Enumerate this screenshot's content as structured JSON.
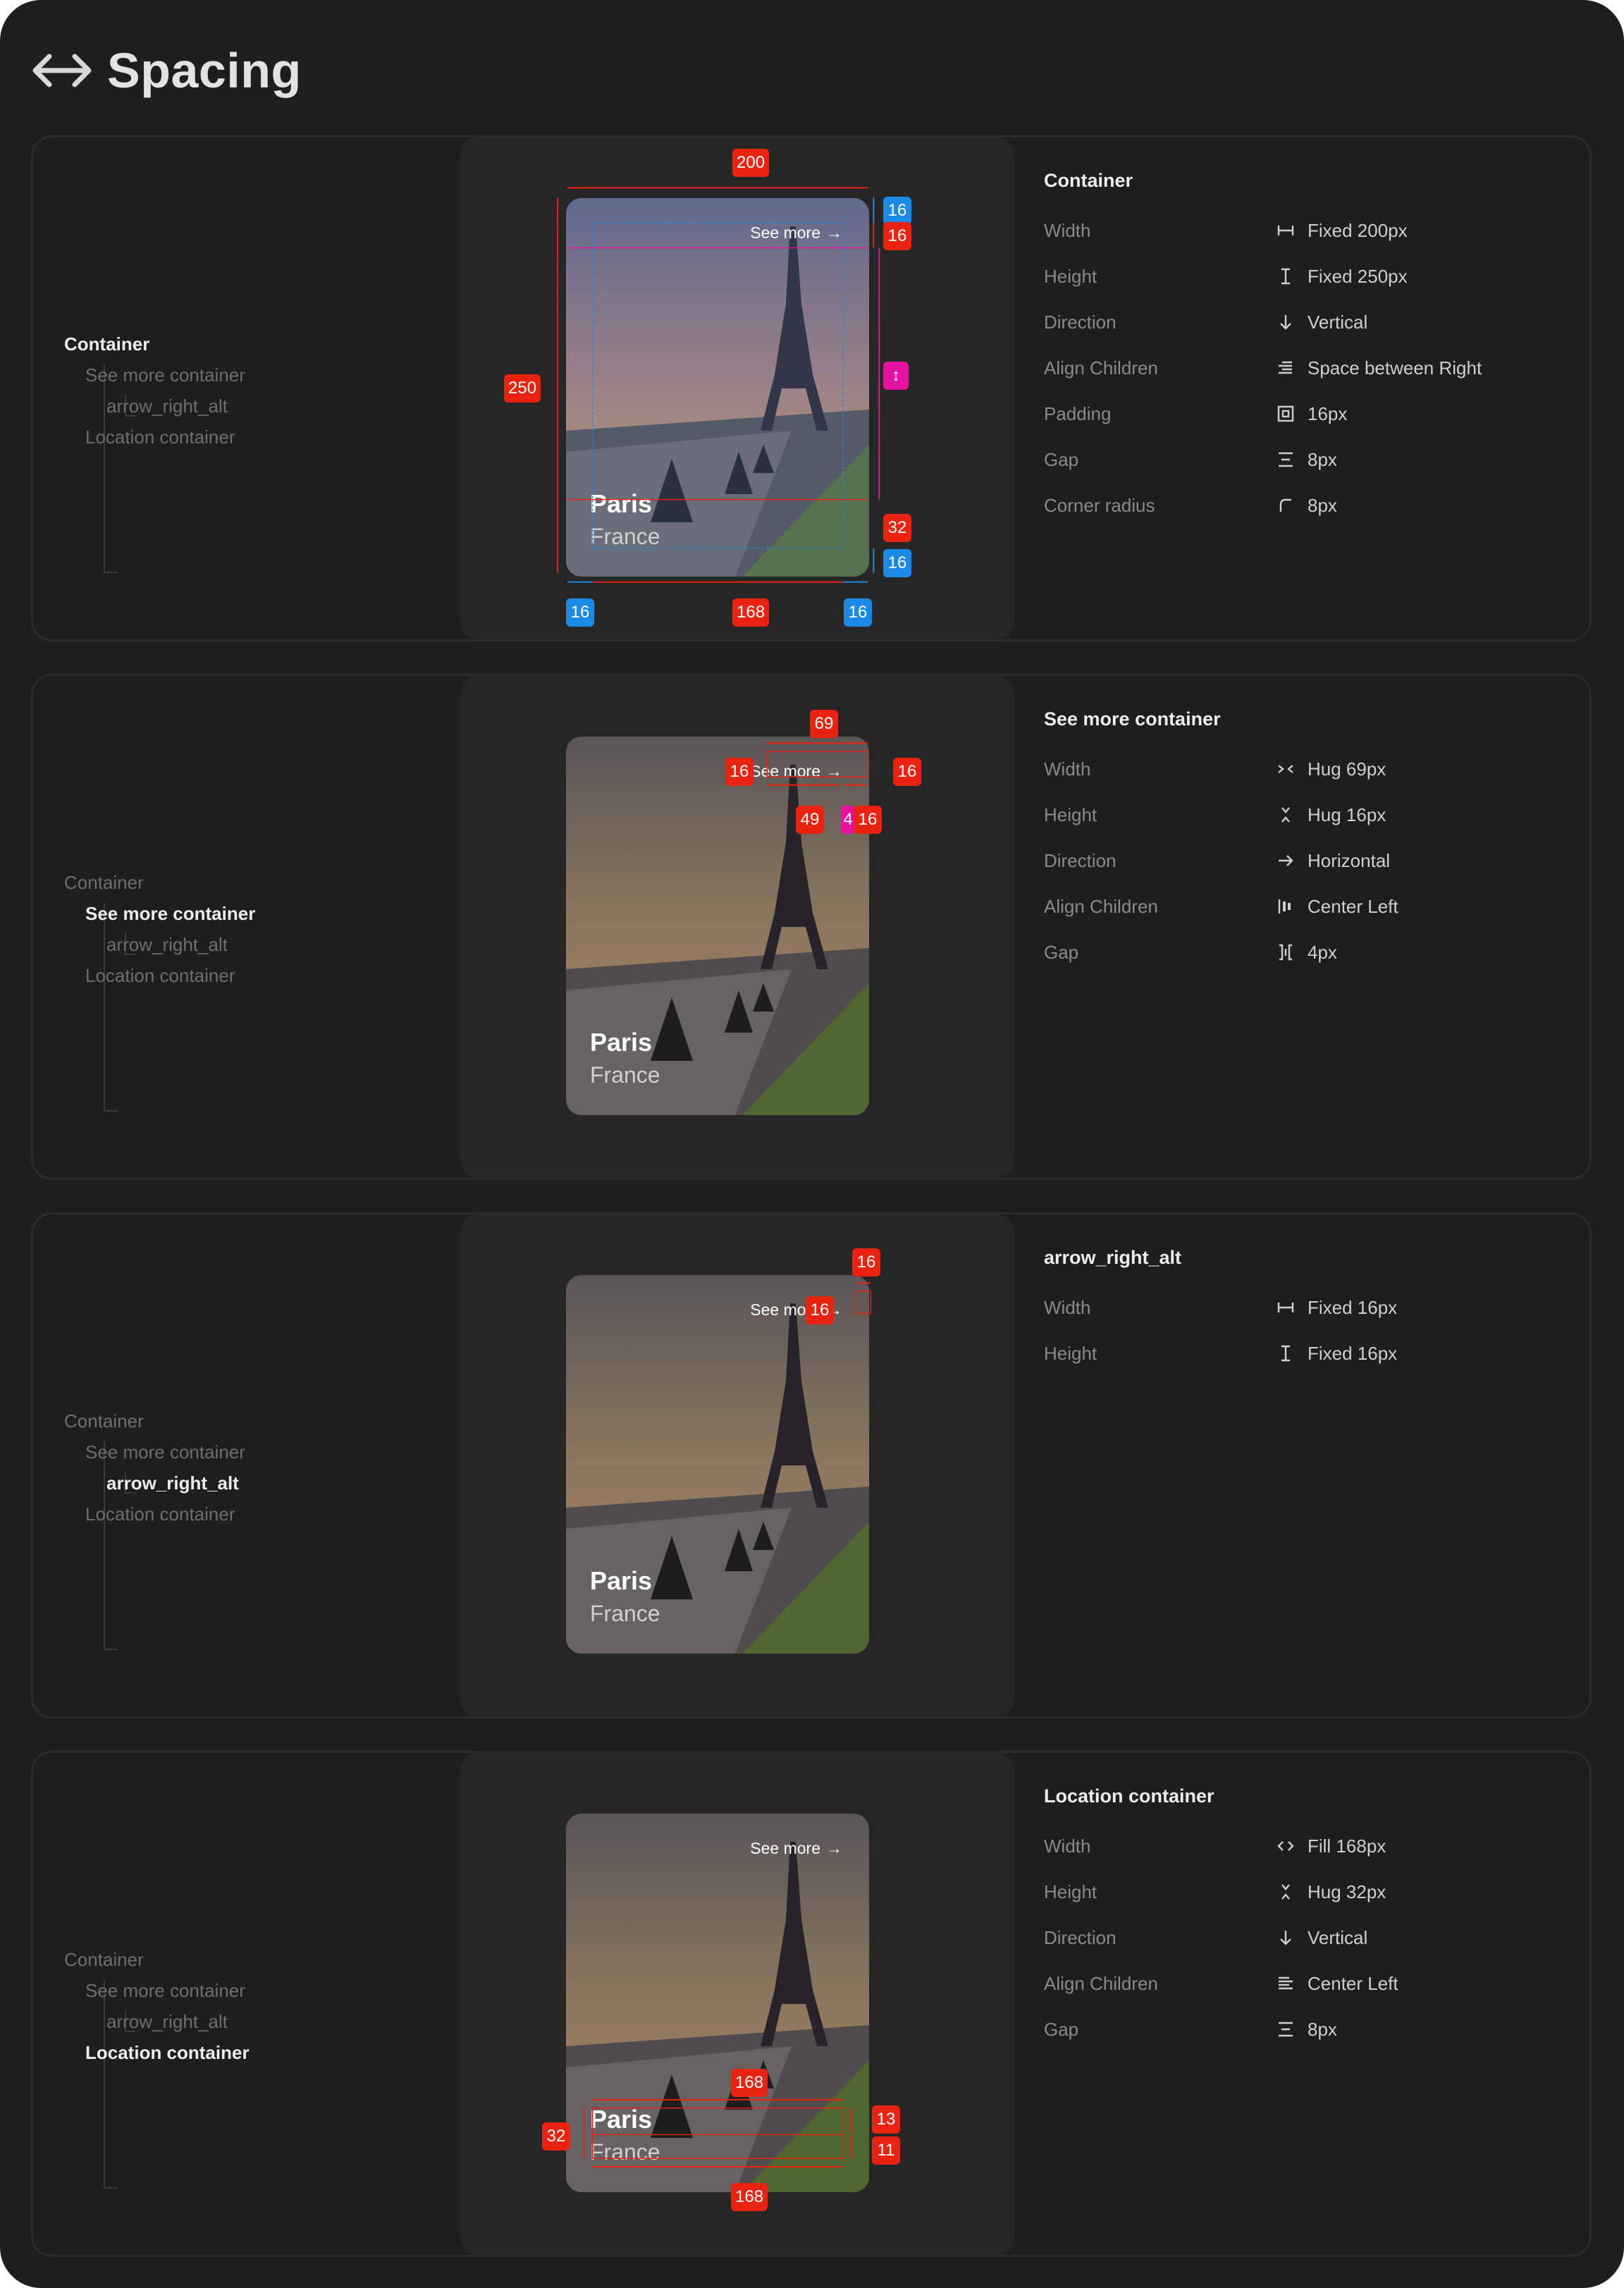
{
  "header": {
    "title": "Spacing"
  },
  "card": {
    "see_more": "See more",
    "city": "Paris",
    "country": "France"
  },
  "panels": [
    {
      "tree": [
        "Container",
        "See more container",
        "arrow_right_alt",
        "Location container"
      ],
      "props_title": "Container",
      "props": [
        {
          "label": "Width",
          "icon": "width-icon",
          "value": "Fixed  200px"
        },
        {
          "label": "Height",
          "icon": "height-icon",
          "value": "Fixed  250px"
        },
        {
          "label": "Direction",
          "icon": "arrow-down-icon",
          "value": "Vertical"
        },
        {
          "label": "Align Children",
          "icon": "align-right-icon",
          "value": "Space between Right"
        },
        {
          "label": "Padding",
          "icon": "padding-icon",
          "value": "16px"
        },
        {
          "label": "Gap",
          "icon": "gap-vertical-icon",
          "value": "8px"
        },
        {
          "label": "Corner radius",
          "icon": "corner-radius-icon",
          "value": "8px"
        }
      ],
      "badges": {
        "w": "200",
        "h": "250",
        "pad_top": "16",
        "sm_h": "16",
        "loc_h": "32",
        "pad_bottom": "16",
        "pad_left": "16",
        "inner_w": "168",
        "pad_right": "16"
      }
    },
    {
      "tree": [
        "Container",
        "See more container",
        "arrow_right_alt",
        "Location container"
      ],
      "props_title": "See more container",
      "props": [
        {
          "label": "Width",
          "icon": "hug-width-icon",
          "value": "Hug  69px"
        },
        {
          "label": "Height",
          "icon": "hug-height-icon",
          "value": "Hug  16px"
        },
        {
          "label": "Direction",
          "icon": "arrow-right-icon",
          "value": "Horizontal"
        },
        {
          "label": "Align Children",
          "icon": "align-center-left-icon",
          "value": "Center Left"
        },
        {
          "label": "Gap",
          "icon": "gap-horizontal-icon",
          "value": "4px"
        }
      ],
      "badges": {
        "w": "69",
        "h_left": "16",
        "h_right": "16",
        "text_w": "49",
        "gap": "4",
        "icon_w": "16"
      }
    },
    {
      "tree": [
        "Container",
        "See more container",
        "arrow_right_alt",
        "Location container"
      ],
      "props_title": "arrow_right_alt",
      "props": [
        {
          "label": "Width",
          "icon": "width-icon",
          "value": "Fixed  16px"
        },
        {
          "label": "Height",
          "icon": "height-icon",
          "value": "Fixed  16px"
        }
      ],
      "badges": {
        "w": "16",
        "h": "16"
      }
    },
    {
      "tree": [
        "Container",
        "See more container",
        "arrow_right_alt",
        "Location container"
      ],
      "props_title": "Location container",
      "props": [
        {
          "label": "Width",
          "icon": "fill-width-icon",
          "value": "Fill  168px"
        },
        {
          "label": "Height",
          "icon": "hug-height-icon",
          "value": "Hug  32px"
        },
        {
          "label": "Direction",
          "icon": "arrow-down-icon",
          "value": "Vertical"
        },
        {
          "label": "Align Children",
          "icon": "align-left-icon",
          "value": "Center Left"
        },
        {
          "label": "Gap",
          "icon": "gap-vertical-icon",
          "value": "8px"
        }
      ],
      "badges": {
        "w_top": "168",
        "h": "32",
        "city_h": "13",
        "country_h": "11",
        "w_bottom": "168"
      }
    }
  ]
}
